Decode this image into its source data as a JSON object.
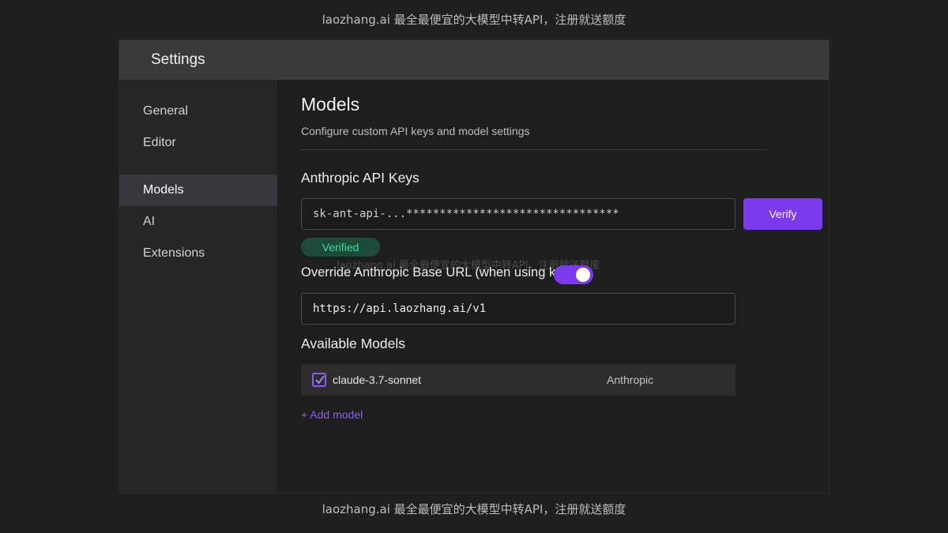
{
  "watermark": "laozhang.ai 最全最便宜的大模型中转API，注册就送额度",
  "window": {
    "title": "Settings"
  },
  "sidebar": {
    "items": [
      {
        "label": "General",
        "active": false
      },
      {
        "label": "Editor",
        "active": false
      },
      {
        "label": "Models",
        "active": true
      },
      {
        "label": "AI",
        "active": false
      },
      {
        "label": "Extensions",
        "active": false
      }
    ]
  },
  "main": {
    "title": "Models",
    "subtitle": "Configure custom API keys and model settings",
    "api_keys": {
      "heading": "Anthropic API Keys",
      "key_value": "sk-ant-api-...********************************",
      "verify_label": "Verify",
      "status": "Verified"
    },
    "base_url": {
      "label": "Override Anthropic Base URL (when using ke",
      "toggle_on": true,
      "value": "https://api.laozhang.ai/v1"
    },
    "models": {
      "heading": "Available Models",
      "rows": [
        {
          "name": "claude-3.7-sonnet",
          "provider": "Anthropic",
          "checked": true
        }
      ],
      "add_label": "+ Add model"
    }
  },
  "colors": {
    "accent": "#7c3aed",
    "verified_bg": "#1d4a3a",
    "verified_text": "#3ddc97",
    "titlebar": "#3a3a3a",
    "sidebar": "#262626"
  }
}
